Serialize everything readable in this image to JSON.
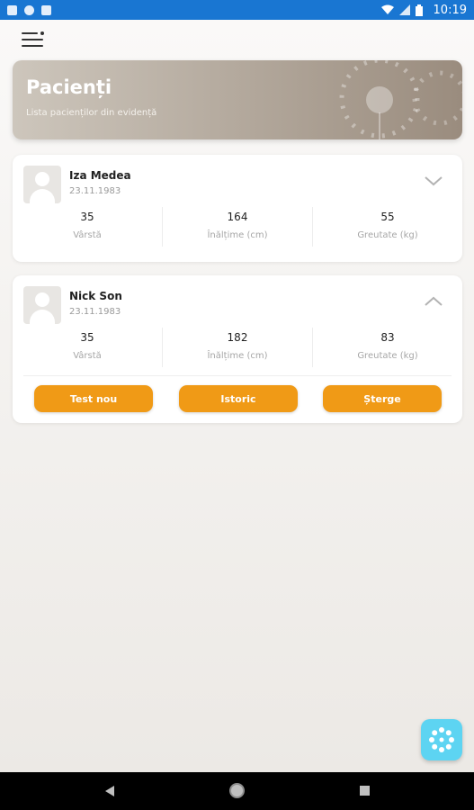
{
  "status_bar": {
    "time": "10:19",
    "icons": [
      "notification-icon",
      "circle-app-icon",
      "sim-icon",
      "wifi-icon",
      "signal-icon",
      "battery-icon"
    ]
  },
  "header": {
    "title": "Pacienți",
    "subtitle": "Lista pacienților din evidență"
  },
  "stat_labels": {
    "age": "Vârstă",
    "height": "Înălțime (cm)",
    "weight": "Greutate (kg)"
  },
  "patients": [
    {
      "name": "Iza Medea",
      "birth_date": "23.11.1983",
      "age": "35",
      "height": "164",
      "weight": "55",
      "expanded": false
    },
    {
      "name": "Nick Son",
      "birth_date": "23.11.1983",
      "age": "35",
      "height": "182",
      "weight": "83",
      "expanded": true
    }
  ],
  "actions": {
    "new_test": "Test nou",
    "history": "Istoric",
    "delete": "Șterge"
  },
  "colors": {
    "status_bar": "#1976d2",
    "accent_orange": "#f09a16",
    "fab": "#5dd4f2",
    "banner_start": "#cdc6bc",
    "banner_end": "#9a8c7e"
  }
}
